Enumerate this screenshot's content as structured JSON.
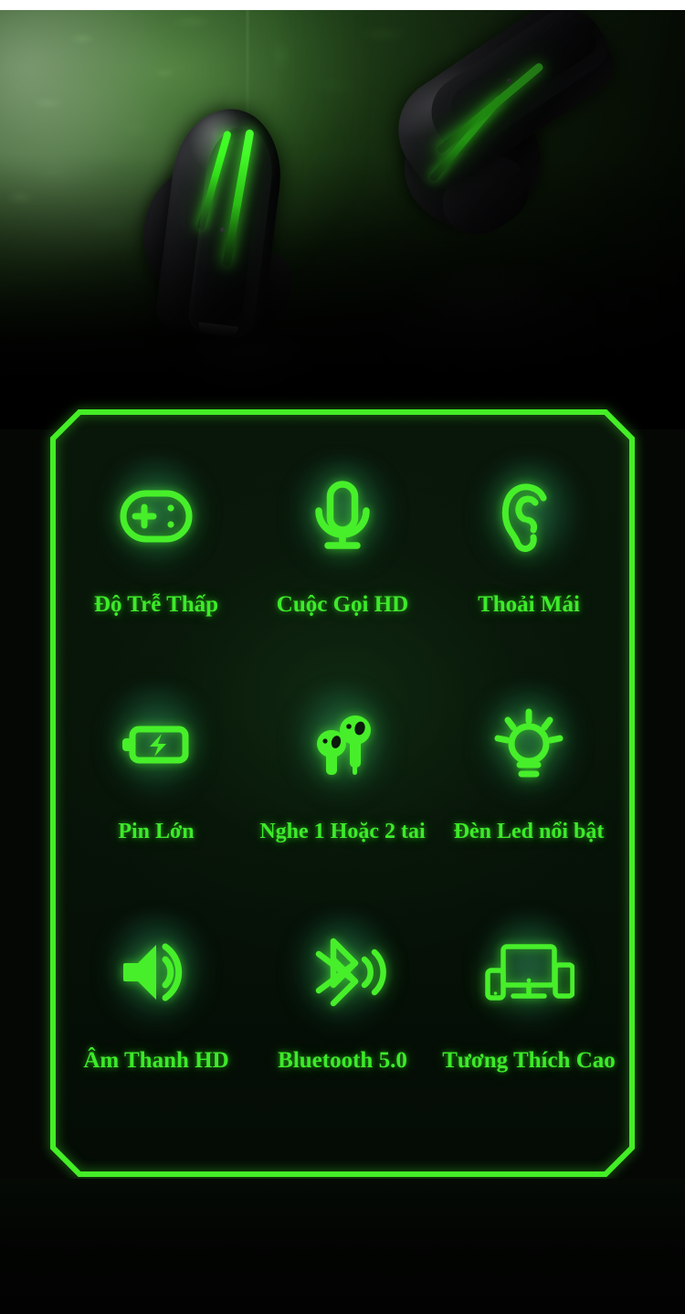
{
  "page": {
    "product_category": "wireless-gaming-earbuds",
    "accent_color": "#3dea2a",
    "panel_background": "#0a1a0b",
    "hero_background": "#1d3a17"
  },
  "hero": {
    "earbud_left_name": "earbud-left",
    "earbud_right_name": "earbud-right",
    "led_strip_color": "#45ff2a"
  },
  "features": {
    "rows": [
      {
        "items": [
          {
            "icon": "gamepad-icon",
            "label": "Độ Trễ Thấp"
          },
          {
            "icon": "microphone-icon",
            "label": "Cuộc Gọi HD"
          },
          {
            "icon": "ear-icon",
            "label": "Thoải Mái"
          }
        ]
      },
      {
        "items": [
          {
            "icon": "battery-charging-icon",
            "label": "Pin Lớn"
          },
          {
            "icon": "earbuds-pair-icon",
            "label": "Nghe 1 Hoặc 2 tai"
          },
          {
            "icon": "lightbulb-icon",
            "label": "Đèn Led nổi bật"
          }
        ]
      },
      {
        "items": [
          {
            "icon": "speaker-volume-icon",
            "label": "Âm Thanh HD"
          },
          {
            "icon": "bluetooth-signal-icon",
            "label": "Bluetooth 5.0"
          },
          {
            "icon": "multi-device-icon",
            "label": "Tương Thích Cao"
          }
        ]
      }
    ]
  }
}
